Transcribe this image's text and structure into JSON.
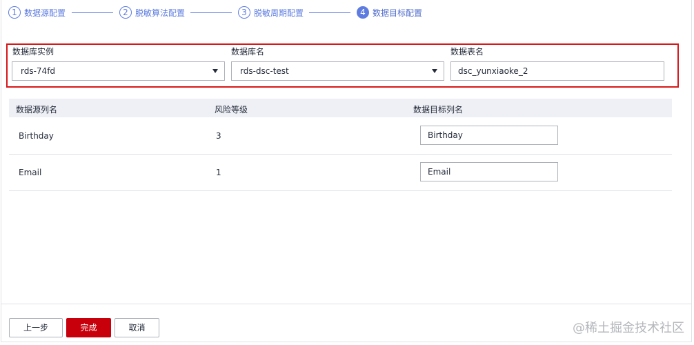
{
  "steps": [
    {
      "num": "1",
      "label": "数据源配置"
    },
    {
      "num": "2",
      "label": "脱敏算法配置"
    },
    {
      "num": "3",
      "label": "脱敏周期配置"
    },
    {
      "num": "4",
      "label": "数据目标配置"
    }
  ],
  "target": {
    "db_instance_label": "数据库实例",
    "db_instance_value": "rds-74fd",
    "db_name_label": "数据库名",
    "db_name_value": "rds-dsc-test",
    "table_name_label": "数据表名",
    "table_name_value": "dsc_yunxiaoke_2"
  },
  "table": {
    "headers": [
      "数据源列名",
      "风险等级",
      "数据目标列名"
    ],
    "rows": [
      {
        "source": "Birthday",
        "risk": "3",
        "target": "Birthday"
      },
      {
        "source": "Email",
        "risk": "1",
        "target": "Email"
      }
    ]
  },
  "footer": {
    "prev_label": "上一步",
    "finish_label": "完成",
    "cancel_label": "取消"
  },
  "watermark": "@稀土掘金技术社区",
  "colors": {
    "accent": "#5e7ce0",
    "primary_button": "#c7000b",
    "highlight_border": "#d71718",
    "table_header_bg": "#eef0f5"
  }
}
